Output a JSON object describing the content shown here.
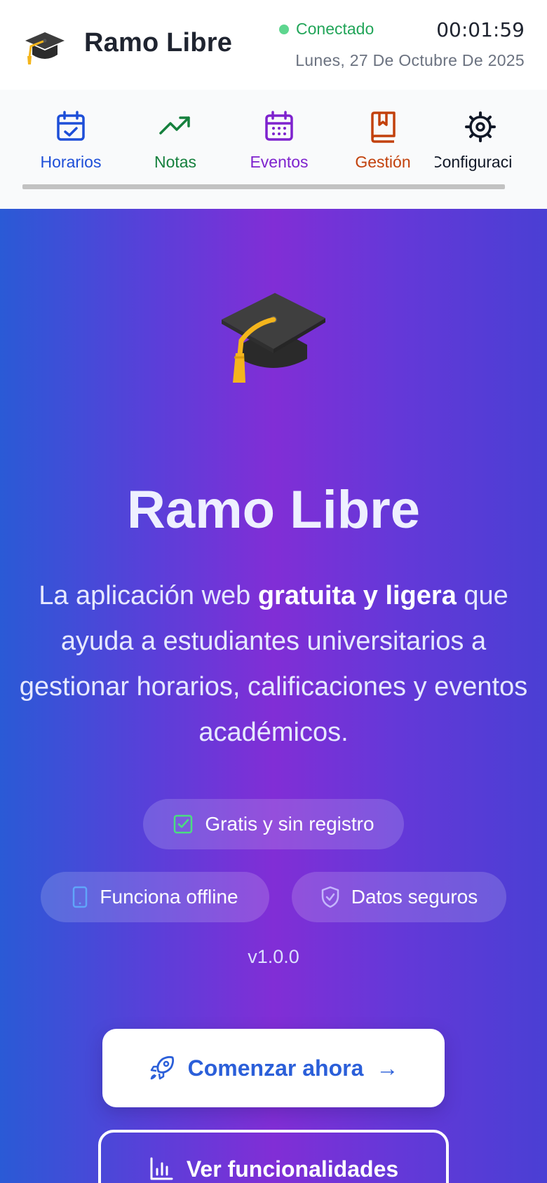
{
  "header": {
    "app_name": "Ramo Libre",
    "status": "Conectado",
    "clock": "00:01:59",
    "date": "Lunes, 27 De Octubre De 2025"
  },
  "nav": {
    "items": [
      {
        "label": "Horarios",
        "icon": "calendar-check-icon",
        "color": "#1d4ed8"
      },
      {
        "label": "Notas",
        "icon": "trending-up-icon",
        "color": "#15803d"
      },
      {
        "label": "Eventos",
        "icon": "calendar-grid-icon",
        "color": "#7e22ce"
      },
      {
        "label": "Gestión",
        "icon": "bookmark-book-icon",
        "color": "#c2410c"
      },
      {
        "label": "Configuraci",
        "icon": "gear-icon",
        "color": "#111827"
      }
    ]
  },
  "hero": {
    "title": "Ramo Libre",
    "desc_prefix": "La aplicación web ",
    "desc_bold": "gratuita y ligera",
    "desc_suffix": " que ayuda a estudiantes universitarios a gestionar horarios, calificaciones y eventos académicos.",
    "badges": [
      {
        "label": "Gratis y sin registro",
        "icon": "check-square-icon",
        "color": "#4ade80"
      },
      {
        "label": "Funciona offline",
        "icon": "smartphone-icon",
        "color": "#60a5fa"
      },
      {
        "label": "Datos seguros",
        "icon": "shield-check-icon",
        "color": "#c4b5fd"
      }
    ],
    "version": "v1.0.0",
    "cta_primary": "Comenzar ahora",
    "cta_primary_arrow": "→",
    "cta_secondary": "Ver funcionalidades"
  },
  "colors": {
    "accent_blue": "#2b5fd9",
    "status_green": "#22a559",
    "gradient_start": "#2a5ad6",
    "gradient_mid": "#812ed6",
    "gradient_end": "#4a3fd4"
  }
}
